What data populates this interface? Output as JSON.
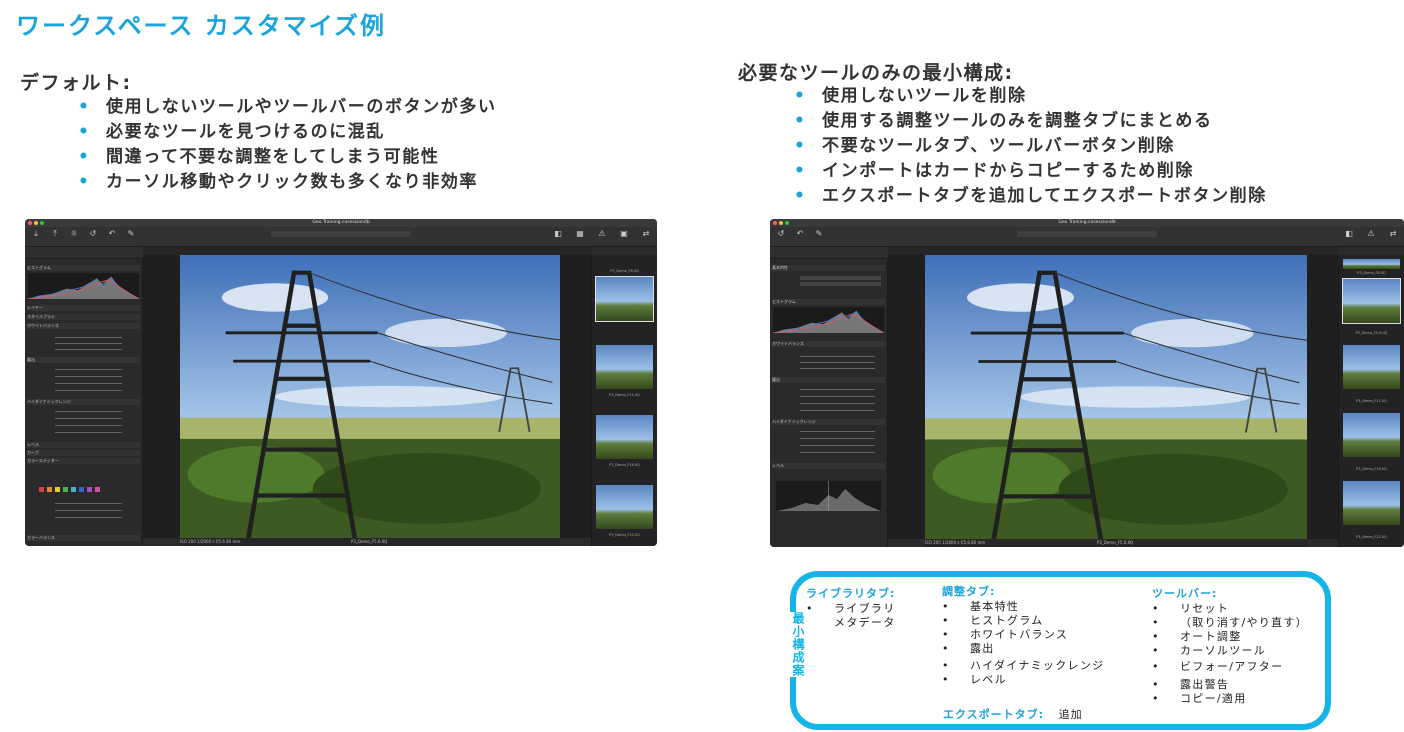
{
  "page_title": "ワークスペース カスタマイズ例",
  "default_section": {
    "heading": "デフォルト:",
    "bullets": [
      "使用しないツールやツールバーのボタンが多い",
      "必要なツールを見つけるのに混乱",
      "間違って不要な調整をしてしまう可能性",
      "カーソル移動やクリック数も多くなり非効率"
    ]
  },
  "minimal_section": {
    "heading": "必要なツールのみの最小構成:",
    "bullets": [
      "使用しないツールを削除",
      "使用する調整ツールのみを調整タブにまとめる",
      "不要なツールタブ、ツールバーボタン削除",
      "インポートはカードからコピーするため削除",
      "エクスポートタブを追加してエクスポートボタン削除"
    ]
  },
  "bullet_symbol": "•",
  "screenshot_left": {
    "window_title": "Geo Training.cosessiondb",
    "panel_rows": [
      "ヒストグラム",
      "レイヤー",
      "スタイルブラシ",
      "ホワイトバランス",
      "露出",
      "ハイダイナミックレンジ",
      "レベル",
      "カーブ",
      "カラーエディター",
      "カラーバランス"
    ],
    "filmstrip_labels": [
      "P3_Demo_F8.IIQ",
      "P3_Demo_F11.IIQ",
      "P3_Demo_F16.IIQ",
      "P3_Demo_F22.IIQ"
    ],
    "footer_info": "ISO 200   1/2000 s   f/5.6   80 mm",
    "footer_file": "P3_Demo_F5.6.IIQ"
  },
  "screenshot_right": {
    "window_title": "Geo Training.cosessiondb",
    "panel_rows": [
      "基本特性",
      "ヒストグラム",
      "ホワイトバランス",
      "露出",
      "ハイダイナミックレンジ",
      "レベル"
    ],
    "filmstrip_labels": [
      "P3_Demo_F8.IIQ",
      "P3_Demo_F5.6.IIQ",
      "P3_Demo_F11.IIQ",
      "P3_Demo_F16.IIQ",
      "P3_Demo_F22.IIQ"
    ],
    "footer_info": "ISO 200   1/2000 s   f/5.6   80 mm",
    "footer_file": "P3_Demo_F5.6.IIQ"
  },
  "config_box": {
    "side_label": "最小構成案",
    "library_tab": {
      "heading": "ライブラリタブ:",
      "items": [
        "ライブラリ",
        "メタデータ"
      ]
    },
    "adjust_tab": {
      "heading": "調整タブ:",
      "items": [
        "基本特性",
        "ヒストグラム",
        "ホワイトバランス",
        "露出",
        "ハイダイナミックレンジ",
        "レベル"
      ]
    },
    "toolbar": {
      "heading": "ツールバー:",
      "items": [
        "リセット",
        "（取り消す/やり直す）",
        "オート調整",
        "カーソルツール",
        "ビフォー/アフター",
        "露出警告",
        "コピー/適用"
      ]
    },
    "export_tab": {
      "label": "エクスポートタブ:",
      "value": "追加"
    }
  },
  "colors": {
    "accent": "#1aa3dd",
    "box_border": "#14b4e8",
    "app_bg": "#2b2b2d"
  }
}
